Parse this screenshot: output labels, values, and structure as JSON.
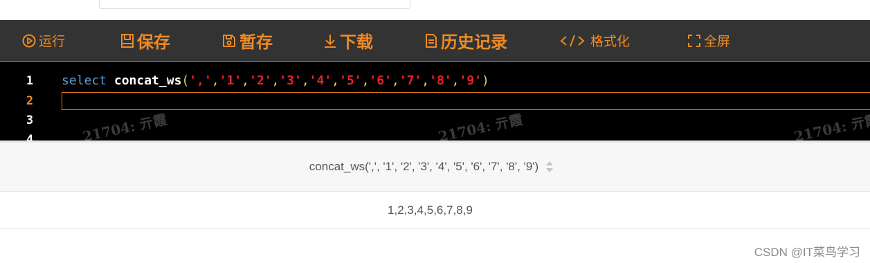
{
  "toolbar": {
    "run_label": "运行",
    "save_label": "保存",
    "temp_save_label": "暂存",
    "download_label": "下载",
    "history_label": "历史记录",
    "format_label": "格式化",
    "fullscreen_label": "全屏"
  },
  "editor": {
    "line_numbers": [
      "1",
      "2",
      "3",
      "4"
    ],
    "keyword": "select",
    "function": "concat_ws",
    "open_paren": "(",
    "close_paren": ")",
    "args": [
      "','",
      "'1'",
      "'2'",
      "'3'",
      "'4'",
      "'5'",
      "'6'",
      "'7'",
      "'8'",
      "'9'"
    ],
    "watermark": "21704: 亓霞"
  },
  "result": {
    "column_header": "concat_ws(',', '1', '2', '3', '4', '5', '6', '7', '8', '9')",
    "cell_value": "1,2,3,4,5,6,7,8,9"
  },
  "credit": "CSDN @IT菜鸟学习",
  "colors": {
    "toolbar_bg": "#333333",
    "accent": "#f08a24",
    "editor_bg": "#000000",
    "keyword": "#569cd6",
    "string": "#e8202b",
    "punctuation": "#f5d547"
  },
  "icons": [
    "play-circle-icon",
    "save-icon",
    "temp-save-icon",
    "download-icon",
    "document-icon",
    "code-icon",
    "fullscreen-icon",
    "sort-icon"
  ]
}
